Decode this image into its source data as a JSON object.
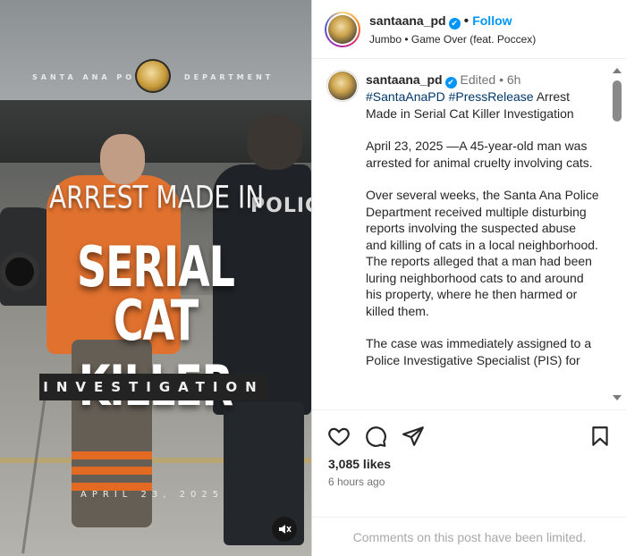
{
  "media": {
    "department_left": "SANTA ANA PO",
    "department_right": "DEPARTMENT",
    "police_word": "POLIC",
    "headline_line1": "ARREST MADE IN",
    "headline_line2": "SERIAL",
    "headline_line3": "CAT KILLER",
    "banner": "INVESTIGATION",
    "date": "APRIL 23, 2025",
    "mute_icon": "muted-speaker-icon"
  },
  "header": {
    "username": "santaana_pd",
    "follow_label": "Follow",
    "separator": "•",
    "verified_icon": "✔",
    "music": "Jumbo • Game Over (feat. Poccex)"
  },
  "caption": {
    "username": "santaana_pd",
    "edited": "Edited",
    "separator": "•",
    "age": "6h",
    "hashtag1": "#SantaAnaPD",
    "hashtag2": "#PressRelease",
    "title": "Arrest Made in Serial Cat Killer Investigation",
    "para1": "April 23, 2025 —A 45-year-old man was arrested for animal cruelty involving cats.",
    "para2": "Over several weeks, the Santa Ana Police Department received multiple disturbing reports involving the suspected abuse and killing of cats in a local neighborhood. The reports alleged that a man had been luring neighborhood cats to and around his property, where he then harmed or killed them.",
    "para3": "The case was immediately assigned to a Police Investigative Specialist (PIS) for"
  },
  "actions": {
    "like_icon": "heart-icon",
    "comment_icon": "comment-icon",
    "share_icon": "paper-plane-icon",
    "save_icon": "bookmark-icon",
    "likes": "3,085 likes",
    "time": "6 hours ago"
  },
  "footer": {
    "comments_limited": "Comments on this post have been limited."
  },
  "colors": {
    "link_blue": "#0095f6",
    "hashtag": "#00376b",
    "muted_text": "#737373",
    "orange_jumpsuit": "#e0712e"
  }
}
